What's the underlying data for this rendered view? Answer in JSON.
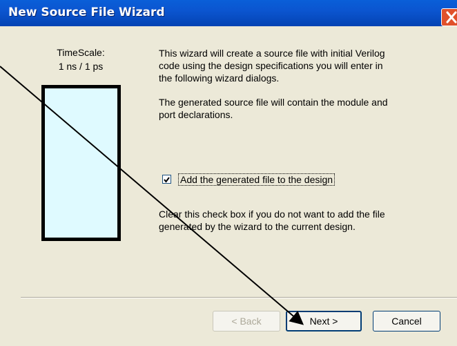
{
  "window": {
    "title": "New Source File Wizard"
  },
  "timescale": {
    "label": "TimeScale:",
    "value": "1 ns / 1 ps"
  },
  "intro": {
    "line1": "This wizard will create a source file with initial Verilog",
    "line2": "code using the design specifications you will enter in",
    "line3": "the following wizard dialogs."
  },
  "generated_note": {
    "line1": "The generated source file will contain the module and",
    "line2": "port declarations."
  },
  "add_to_design": {
    "checked": true,
    "label": "Add the generated file to the design"
  },
  "clear_note": {
    "line1": "Clear this check box if you do not want to add the file",
    "line2": "generated by the wizard to the current design."
  },
  "buttons": {
    "back": "< Back",
    "next": "Next >",
    "cancel": "Cancel"
  },
  "colors": {
    "titlebar": "#0b55d0",
    "preview_fill": "#dffaff",
    "close": "#e0512b"
  }
}
